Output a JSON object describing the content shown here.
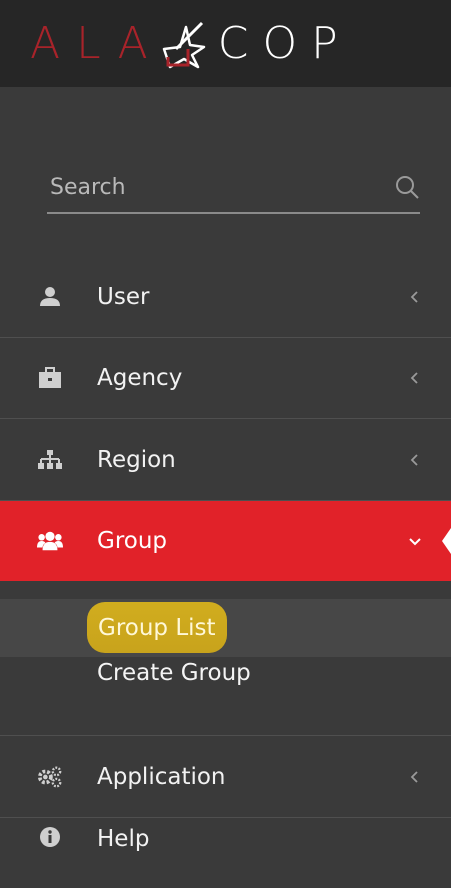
{
  "brand": {
    "logo_left": "ALA",
    "logo_right": "COP",
    "logo_left_color": "#a8232a",
    "logo_right_color": "#ffffff"
  },
  "search": {
    "placeholder": "Search",
    "icon": "search-icon"
  },
  "nav": {
    "items": [
      {
        "label": "User",
        "icon": "user-icon",
        "expanded": false
      },
      {
        "label": "Agency",
        "icon": "briefcase-icon",
        "expanded": false
      },
      {
        "label": "Region",
        "icon": "sitemap-icon",
        "expanded": false
      },
      {
        "label": "Group",
        "icon": "users-icon",
        "expanded": true,
        "active": true
      },
      {
        "label": "Application",
        "icon": "gears-icon",
        "expanded": false
      },
      {
        "label": "Help",
        "icon": "info-icon",
        "expanded": false
      }
    ],
    "group_submenu": [
      {
        "label": "Group List",
        "selected": true
      },
      {
        "label": "Create Group",
        "selected": false
      }
    ]
  },
  "colors": {
    "sidebar_bg": "#3a3a3a",
    "header_bg": "#262626",
    "active_bg": "#e12229",
    "highlight": "#d1ad1e"
  }
}
